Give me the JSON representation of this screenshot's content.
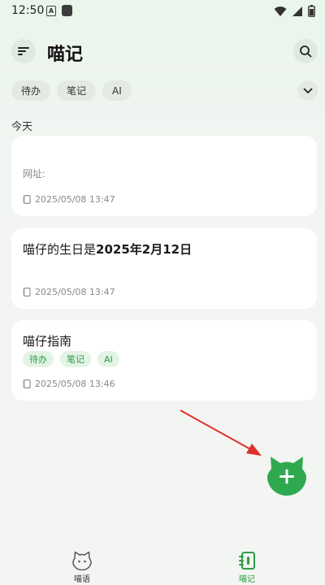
{
  "status_bar": {
    "time": "12:50",
    "notif_letter": "A"
  },
  "header": {
    "title": "喵记"
  },
  "filters": [
    "待办",
    "笔记",
    "AI"
  ],
  "section": {
    "today_label": "今天"
  },
  "notes": [
    {
      "title": "",
      "body": "网址:",
      "date": "2025/05/08 13:47"
    },
    {
      "title_prefix": "喵仔的生日是",
      "title_bold": "2025年2月12日",
      "date": "2025/05/08 13:47"
    },
    {
      "title": "喵仔指南",
      "tags": [
        "待办",
        "笔记",
        "AI"
      ],
      "date": "2025/05/08 13:46"
    }
  ],
  "bottom_nav": {
    "chat_label": "喵语",
    "notes_label": "喵记"
  },
  "colors": {
    "accent": "#2e9b47",
    "fab": "#2fa84f",
    "arrow": "#e0302a"
  }
}
